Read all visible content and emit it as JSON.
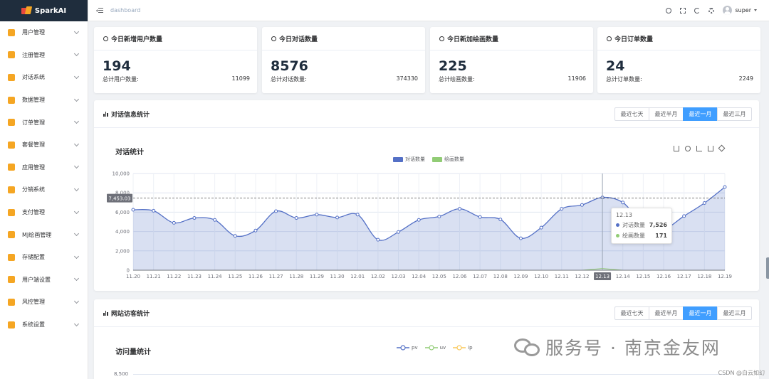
{
  "app": {
    "name": "SparkAI"
  },
  "header": {
    "breadcrumb": "dashboard",
    "username": "super"
  },
  "sidebar": {
    "items": [
      {
        "label": "用户管理",
        "icon": "user-icon",
        "color": "#f5a623"
      },
      {
        "label": "注册管理",
        "icon": "register-icon",
        "color": "#f5a623"
      },
      {
        "label": "对话系统",
        "icon": "chat-icon",
        "color": "#f5a623"
      },
      {
        "label": "数据管理",
        "icon": "data-icon",
        "color": "#f5a623"
      },
      {
        "label": "订单管理",
        "icon": "order-icon",
        "color": "#f5a623"
      },
      {
        "label": "套餐管理",
        "icon": "package-icon",
        "color": "#f5a623"
      },
      {
        "label": "应用管理",
        "icon": "app-icon",
        "color": "#f5a623"
      },
      {
        "label": "分销系统",
        "icon": "distribution-icon",
        "color": "#f5a623"
      },
      {
        "label": "支付管理",
        "icon": "payment-icon",
        "color": "#f5a623"
      },
      {
        "label": "MJ绘画管理",
        "icon": "mj-icon",
        "color": "#f5a623"
      },
      {
        "label": "存储配置",
        "icon": "storage-icon",
        "color": "#f5a623"
      },
      {
        "label": "用户端设置",
        "icon": "client-icon",
        "color": "#f5a623"
      },
      {
        "label": "风控管理",
        "icon": "shield-icon",
        "color": "#f5a623"
      },
      {
        "label": "系统设置",
        "icon": "gear-icon",
        "color": "#f5a623"
      }
    ]
  },
  "stats": [
    {
      "title": "今日新增用户数量",
      "value": "194",
      "total_label": "总计用户数量:",
      "total": "11099",
      "icon": "user-icon"
    },
    {
      "title": "今日对话数量",
      "value": "8576",
      "total_label": "总计对话数量:",
      "total": "374330",
      "icon": "chat-icon"
    },
    {
      "title": "今日新加绘画数量",
      "value": "225",
      "total_label": "总计绘画数量:",
      "total": "11906",
      "icon": "brush-icon"
    },
    {
      "title": "今日订单数量",
      "value": "24",
      "total_label": "总计订单数量:",
      "total": "2249",
      "icon": "order-icon"
    }
  ],
  "ranges": [
    "最近七天",
    "最近半月",
    "最近一月",
    "最近三月"
  ],
  "chat_panel": {
    "title": "对话信息统计",
    "active_range": 2,
    "tooltip": {
      "date": "12.13",
      "rows": [
        {
          "name": "对话数量",
          "value": "7,526"
        },
        {
          "name": "绘画数量",
          "value": "171"
        }
      ]
    },
    "crosshair_label": "7,453.03",
    "highlight_x_label": "12.13"
  },
  "visit_panel": {
    "title": "网站访客统计",
    "active_range": 2,
    "chart_title": "访问量统计",
    "legend": [
      "pv",
      "uv",
      "ip"
    ],
    "y_top_label": "8,500"
  },
  "colors": {
    "primary": "#409eff",
    "series1": "#5470c6",
    "series2": "#91cc75",
    "series3": "#fac858",
    "sidebar_top": "#1f2d3d"
  },
  "chart_data": {
    "type": "area",
    "title": "对话统计",
    "x": [
      "11.20",
      "11.21",
      "11.22",
      "11.23",
      "11.24",
      "11.25",
      "11.26",
      "11.27",
      "11.28",
      "11.29",
      "11.30",
      "12.01",
      "12.02",
      "12.03",
      "12.04",
      "12.05",
      "12.06",
      "12.07",
      "12.08",
      "12.09",
      "12.10",
      "12.11",
      "12.12",
      "12.13",
      "12.14",
      "12.15",
      "12.16",
      "12.17",
      "12.18",
      "12.19"
    ],
    "series": [
      {
        "name": "对话数量",
        "values": [
          6250,
          6150,
          4900,
          5400,
          5200,
          3550,
          4100,
          6100,
          5400,
          5750,
          5450,
          5750,
          3150,
          3950,
          5200,
          5550,
          6350,
          5500,
          5250,
          3300,
          4400,
          6350,
          6750,
          7526,
          7000,
          4800,
          4250,
          5600,
          6950,
          8600
        ]
      },
      {
        "name": "绘画数量",
        "values": [
          0,
          0,
          0,
          0,
          0,
          0,
          0,
          0,
          0,
          0,
          0,
          0,
          0,
          0,
          0,
          0,
          0,
          0,
          0,
          0,
          0,
          0,
          0,
          171,
          0,
          0,
          0,
          0,
          0,
          0
        ]
      }
    ],
    "ylim": [
      0,
      10000
    ],
    "yticks": [
      "0",
      "2,000",
      "4,000",
      "6,000",
      "8,000",
      "10,000"
    ]
  },
  "watermark": {
    "text": "服务号 · 南京金友网",
    "csdn": "CSDN @白云如幻"
  }
}
